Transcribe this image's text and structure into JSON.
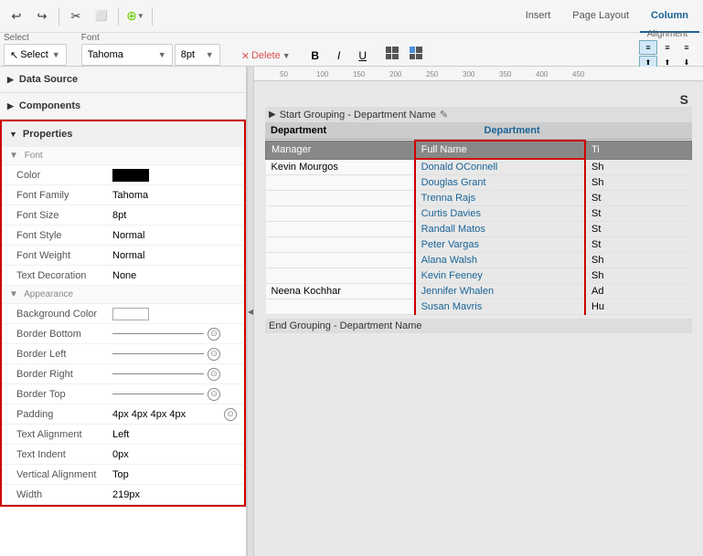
{
  "toolbar": {
    "tabs": [
      "Insert",
      "Page Layout",
      "Column"
    ],
    "active_tab": "Column",
    "undo_icon": "↩",
    "redo_icon": "↪",
    "cut_icon": "✂",
    "copy_icon": "⬜",
    "paste_icon": "📋",
    "select_label": "Select",
    "select_btn": "Select",
    "delete_btn": "Delete",
    "font_name": "Tahoma",
    "font_size": "8pt",
    "bold": "B",
    "italic": "I",
    "underline": "U",
    "alignment_label": "Alignment"
  },
  "left_panel": {
    "data_source_label": "Data Source",
    "components_label": "Components",
    "properties_label": "Properties",
    "font_section": "Font",
    "appearance_section": "Appearance",
    "props": {
      "color_label": "Color",
      "font_family_label": "Font Family",
      "font_family_value": "Tahoma",
      "font_size_label": "Font Size",
      "font_size_value": "8pt",
      "font_style_label": "Font Style",
      "font_style_value": "Normal",
      "font_weight_label": "Font Weight",
      "font_weight_value": "Normal",
      "text_decoration_label": "Text Decoration",
      "text_decoration_value": "None",
      "bg_color_label": "Background Color",
      "border_bottom_label": "Border Bottom",
      "border_left_label": "Border Left",
      "border_right_label": "Border Right",
      "border_top_label": "Border Top",
      "padding_label": "Padding",
      "padding_value": "4px 4px 4px 4px",
      "text_align_label": "Text Alignment",
      "text_align_value": "Left",
      "text_indent_label": "Text Indent",
      "text_indent_value": "0px",
      "vertical_align_label": "Vertical Alignment",
      "vertical_align_value": "Top",
      "width_label": "Width",
      "width_value": "219px"
    }
  },
  "report": {
    "grouping_start": "Start Grouping - Department Name",
    "grouping_end": "End Grouping - Department Name",
    "dept_header1": "Department",
    "dept_header2": "Department",
    "col_headers": [
      "Manager",
      "Full Name",
      "Ti"
    ],
    "rows": [
      {
        "manager": "Kevin Mourgos",
        "fullname": "Donald OConnell",
        "title": "Sh"
      },
      {
        "manager": "",
        "fullname": "Douglas Grant",
        "title": "Sh"
      },
      {
        "manager": "",
        "fullname": "Trenna Rajs",
        "title": "St"
      },
      {
        "manager": "",
        "fullname": "Curtis Davies",
        "title": "St"
      },
      {
        "manager": "",
        "fullname": "Randall Matos",
        "title": "St"
      },
      {
        "manager": "",
        "fullname": "Peter Vargas",
        "title": "St"
      },
      {
        "manager": "",
        "fullname": "Alana Walsh",
        "title": "Sh"
      },
      {
        "manager": "",
        "fullname": "Kevin Feeney",
        "title": "Sh"
      },
      {
        "manager": "Neena Kochhar",
        "fullname": "Jennifer Whalen",
        "title": "Ad"
      },
      {
        "manager": "",
        "fullname": "Susan Mavris",
        "title": "Hu"
      }
    ]
  },
  "ruler": {
    "marks": [
      "50",
      "100",
      "150",
      "200",
      "250",
      "300",
      "350",
      "400",
      "450"
    ]
  }
}
